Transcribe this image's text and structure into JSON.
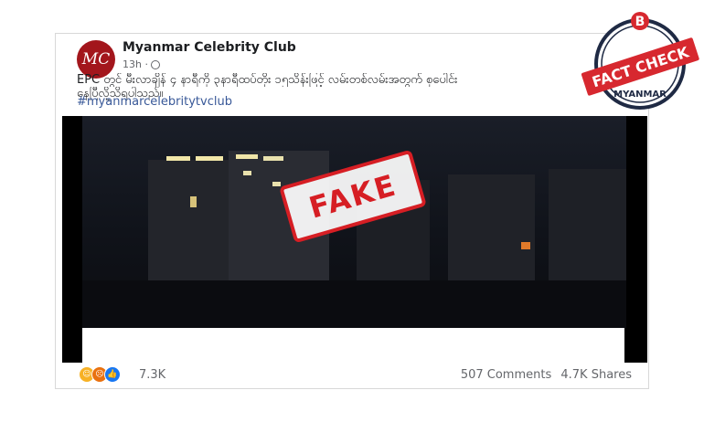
{
  "post": {
    "page_name": "Myanmar Celebrity Club",
    "avatar_text": "MC",
    "time": "13h ·",
    "text_line1": "EPC တွင် မီးလာချိန် ၄ နာရီကို ၃နာရီထပ်တိုး ၁၅သိန်းဖြင့် လမ်းတစ်လမ်းအတွက် စုပေါင်း",
    "text_line2": "နေပြီလို့သိရပါသည်။",
    "hashtag": "#myanmarcelebritytvclub"
  },
  "video": {
    "stamp_text": "FAKE",
    "stamp_color": "#d61e24"
  },
  "footer": {
    "reaction_icons": [
      "haha-icon",
      "angry-icon",
      "like-icon"
    ],
    "reaction_count": "7.3K",
    "comments": "507 Comments",
    "shares": "4.7K Shares"
  },
  "badge": {
    "letter": "B",
    "title": "FACT CHECK",
    "subtitle": "MYANMAR",
    "accent": "#d7282f",
    "dark": "#1f2a44"
  }
}
